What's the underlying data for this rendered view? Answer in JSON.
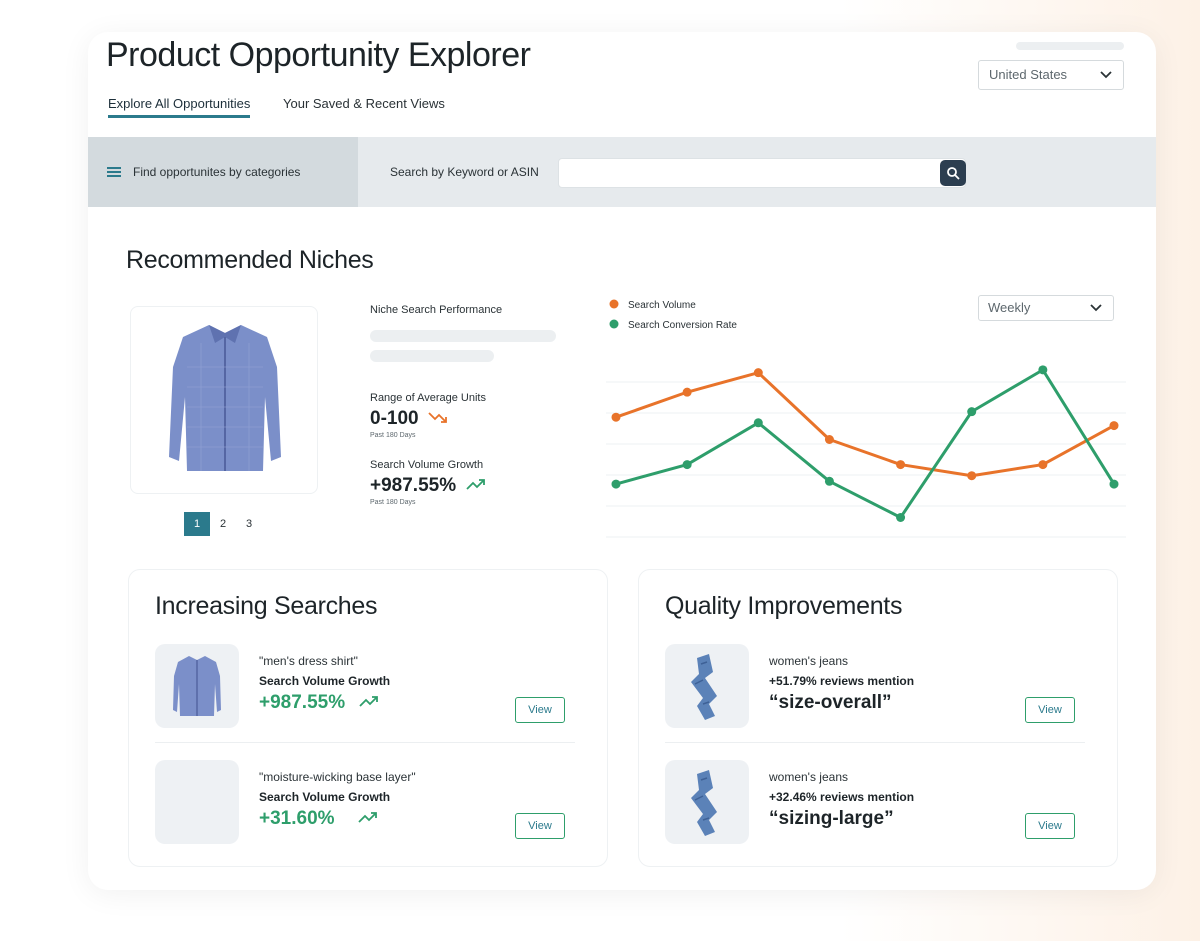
{
  "header": {
    "title": "Product Opportunity Explorer",
    "country": "United States",
    "tabs": [
      {
        "label": "Explore All Opportunities",
        "active": true
      },
      {
        "label": "Your Saved & Recent Views",
        "active": false
      }
    ]
  },
  "search": {
    "category_label": "Find opportunites by categories",
    "keyword_label": "Search by Keyword or ASIN",
    "placeholder": ""
  },
  "recommended": {
    "title": "Recommended Niches",
    "pages": [
      "1",
      "2",
      "3"
    ],
    "active_page": "1",
    "stats": {
      "niche_perf_label": "Niche Search Performance",
      "avg_units_label": "Range of Average Units",
      "avg_units_value": "0-100",
      "avg_units_period": "Past 180 Days",
      "growth_label": "Search Volume Growth",
      "growth_value": "+987.55%",
      "growth_period": "Past 180 Days"
    },
    "period_select": "Weekly"
  },
  "chart_data": {
    "type": "line",
    "x": [
      1,
      2,
      3,
      4,
      5,
      6,
      7,
      8
    ],
    "series": [
      {
        "name": "Search Volume",
        "color": "#e8732a",
        "values": [
          63,
          72,
          79,
          55,
          46,
          42,
          46,
          60
        ]
      },
      {
        "name": "Search Conversion Rate",
        "color": "#2e9e6b",
        "values": [
          39,
          46,
          61,
          40,
          27,
          65,
          80,
          39
        ]
      }
    ],
    "ylim": [
      20,
      90
    ],
    "grid": true,
    "legend": "top-left"
  },
  "increasing": {
    "title": "Increasing Searches",
    "items": [
      {
        "query": "\"men's dress shirt\"",
        "metric_label": "Search Volume Growth",
        "value": "+987.55%",
        "button": "View"
      },
      {
        "query": "\"moisture-wicking base layer\"",
        "metric_label": "Search Volume Growth",
        "value": "+31.60%",
        "button": "View"
      }
    ]
  },
  "quality": {
    "title": "Quality Improvements",
    "items": [
      {
        "product": "women's jeans",
        "mention": "+51.79% reviews mention",
        "topic": "“size-overall”",
        "button": "View"
      },
      {
        "product": "women's jeans",
        "mention": "+32.46% reviews mention",
        "topic": "“sizing-large”",
        "button": "View"
      }
    ]
  },
  "colors": {
    "accent": "#2b7a8c",
    "positive": "#2e9e6b",
    "volume": "#e8732a"
  }
}
